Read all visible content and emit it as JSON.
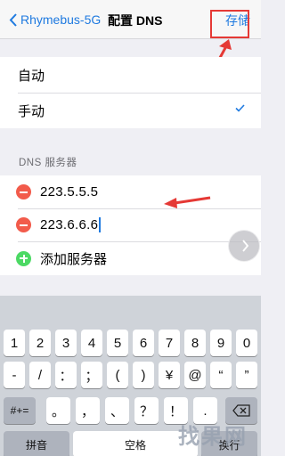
{
  "nav": {
    "back_label": "Rhymebus-5G",
    "title": "配置 DNS",
    "save_label": "存储"
  },
  "mode": {
    "auto_label": "自动",
    "manual_label": "手动",
    "selected": "manual"
  },
  "dns": {
    "section_header": "DNS 服务器",
    "servers": [
      "223.5.5.5",
      "223.6.6.6"
    ],
    "add_label": "添加服务器"
  },
  "keyboard": {
    "row1": [
      "1",
      "2",
      "3",
      "4",
      "5",
      "6",
      "7",
      "8",
      "9",
      "0"
    ],
    "row2": [
      "-",
      "/",
      "：",
      "；",
      "(",
      ")",
      "¥",
      "@",
      "“",
      "”"
    ],
    "row3_shift": "#+=",
    "row3": [
      "。",
      "，",
      "、",
      "？",
      "！",
      "."
    ],
    "row4_left": "拼音",
    "row4_space": "空格",
    "row4_right": "换行"
  },
  "watermark": "找果网",
  "colors": {
    "accent": "#1f7ae0",
    "annotation_red": "#e53935",
    "delete_red": "#f25b4b",
    "add_green": "#4cd964"
  }
}
